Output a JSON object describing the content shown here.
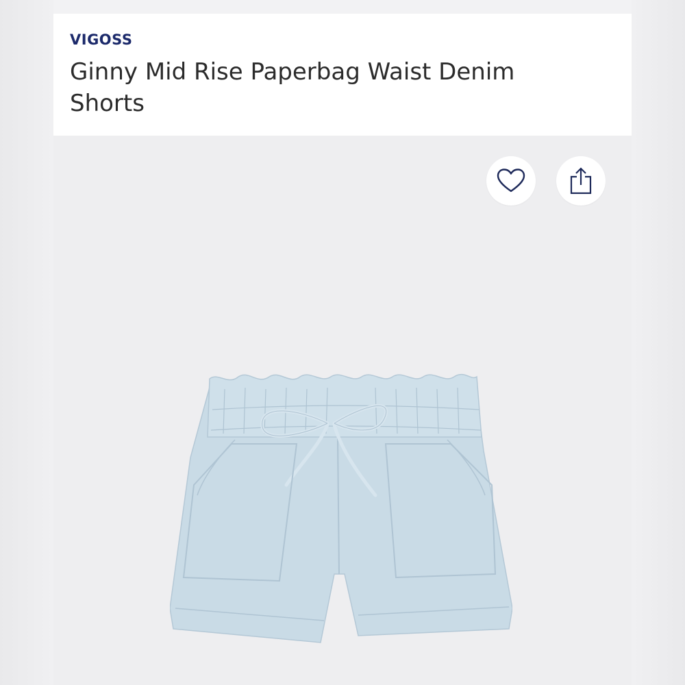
{
  "product": {
    "brand": "VIGOSS",
    "title": "Ginny Mid Rise Paperbag Waist Denim Shorts"
  },
  "actions": {
    "favorite_icon": "heart-icon",
    "share_icon": "share-icon"
  },
  "image": {
    "subject": "denim-shorts-image"
  },
  "colors": {
    "brand": "#1c2a6b",
    "title": "#2b2b2b",
    "background": "#eeeef0",
    "denim": "#c9dbe6"
  }
}
